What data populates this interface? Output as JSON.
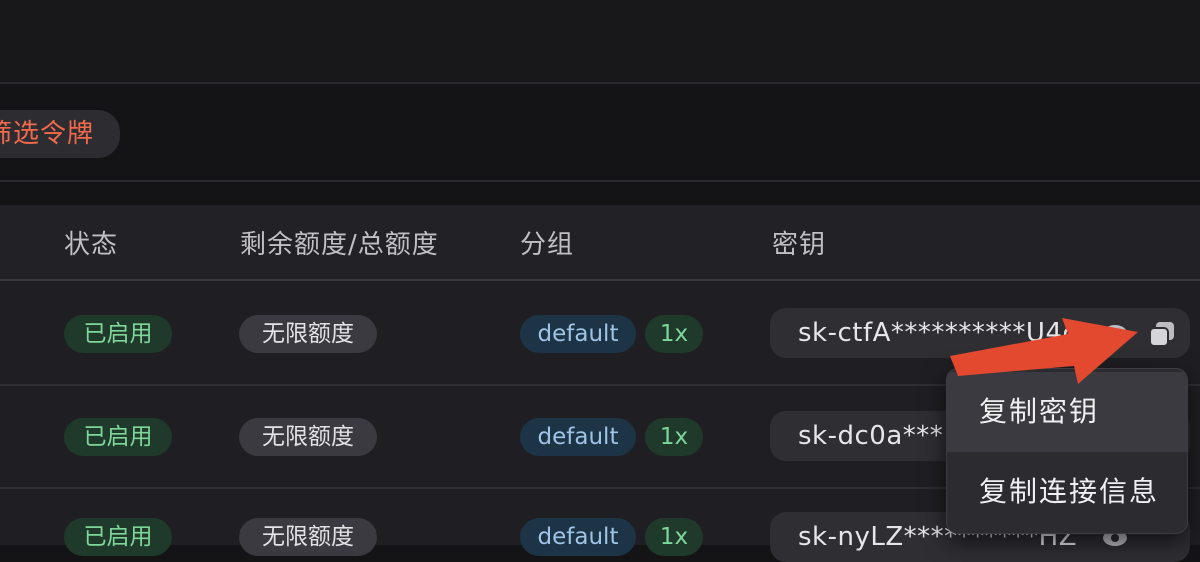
{
  "filter": {
    "label": "筛选令牌"
  },
  "table": {
    "headers": {
      "status": "状态",
      "quota": "剩余额度/总额度",
      "group": "分组",
      "key": "密钥"
    },
    "rows": [
      {
        "status": "已启用",
        "quota": "无限额度",
        "group": "default",
        "ratio": "1x",
        "key": "sk-ctfA**********U4c"
      },
      {
        "status": "已启用",
        "quota": "无限额度",
        "group": "default",
        "ratio": "1x",
        "key": "sk-dc0a***"
      },
      {
        "status": "已启用",
        "quota": "无限额度",
        "group": "default",
        "ratio": "1x",
        "key": "sk-nyLZ**********HZ"
      }
    ]
  },
  "context_menu": {
    "items": [
      "复制密钥",
      "复制连接信息"
    ]
  },
  "colors": {
    "accent": "#f26a4b",
    "annotation_arrow": "#e2492f",
    "status_green": "#7fd69a",
    "group_blue": "#9fc4e6"
  }
}
